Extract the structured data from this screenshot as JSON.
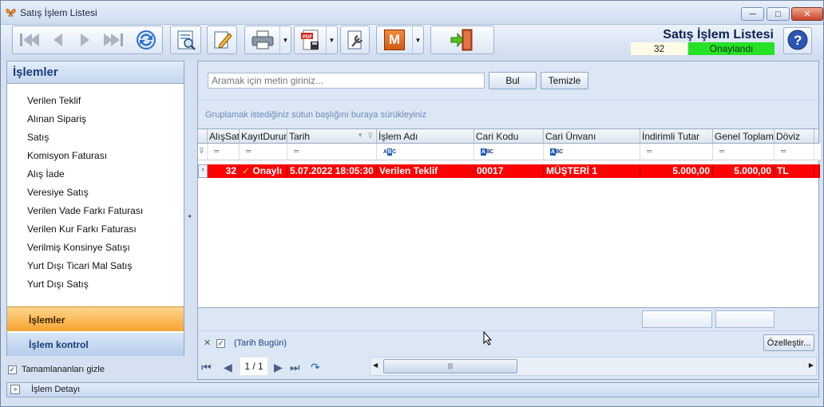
{
  "window": {
    "title": "Satış İşlem Listesi",
    "controls": {
      "minimize": "─",
      "maximize": "□",
      "close": "✕"
    }
  },
  "toolbar": {
    "icons": [
      "first-icon",
      "prev-icon",
      "next-icon",
      "last-icon",
      "refresh-icon",
      "preview-icon",
      "edit-icon",
      "print-icon",
      "pdf-icon",
      "settings-icon",
      "m-icon",
      "exit-icon"
    ],
    "m_label": "M",
    "page_title": "Satış İşlem Listesi",
    "count": "32",
    "status": "Onaylandı",
    "status_color": "#27e127"
  },
  "left_panel": {
    "header": "İşlemler",
    "items": [
      "Verilen Teklif",
      "Alınan Sipariş",
      "Satış",
      "Komisyon Faturası",
      "Alış İade",
      "Veresiye Satış",
      "Verilen Vade Farkı Faturası",
      "Verilen Kur Farkı Faturası",
      "Verilmiş Konsinye Satışı",
      "Yurt Dışı Ticari Mal Satış",
      "Yurt Dışı Satış"
    ],
    "nav_active": "İşlemler",
    "nav_other": "İşlem kontrol",
    "hide_completed": "Tamamlananları gizle"
  },
  "search": {
    "placeholder": "Aramak için metin giriniz...",
    "find_button": "Bul",
    "clear_button": "Temizle"
  },
  "grid": {
    "group_hint": "Gruplamak istediğiniz sütun başlığını buraya sürükleyiniz",
    "columns": [
      "AlışSatış",
      "KayıtDurum",
      "Tarih",
      "İşlem Adı",
      "Cari Kodu",
      "Cari Ünvanı",
      "İndirimli Tutar",
      "Genel Toplam",
      "Döviz"
    ],
    "rows": [
      {
        "alis_satis": "32",
        "kayit_durum": "Onaylı",
        "tarih": "5.07.2022 18:05:30",
        "islem_adi": "Verilen Teklif",
        "cari_kodu": "00017",
        "cari_unvani": "MÜŞTERİ 1",
        "indirimli_tutar": "5.000,00",
        "genel_toplam": "5.000,00",
        "doviz": "TL",
        "row_color": "#fc0202"
      }
    ]
  },
  "filter": {
    "text": "(Tarih Bugün)",
    "customize_button": "Özelleştir..."
  },
  "pager": {
    "page": "1 / 1"
  },
  "bottom": {
    "label": "İşlem Detayı"
  }
}
